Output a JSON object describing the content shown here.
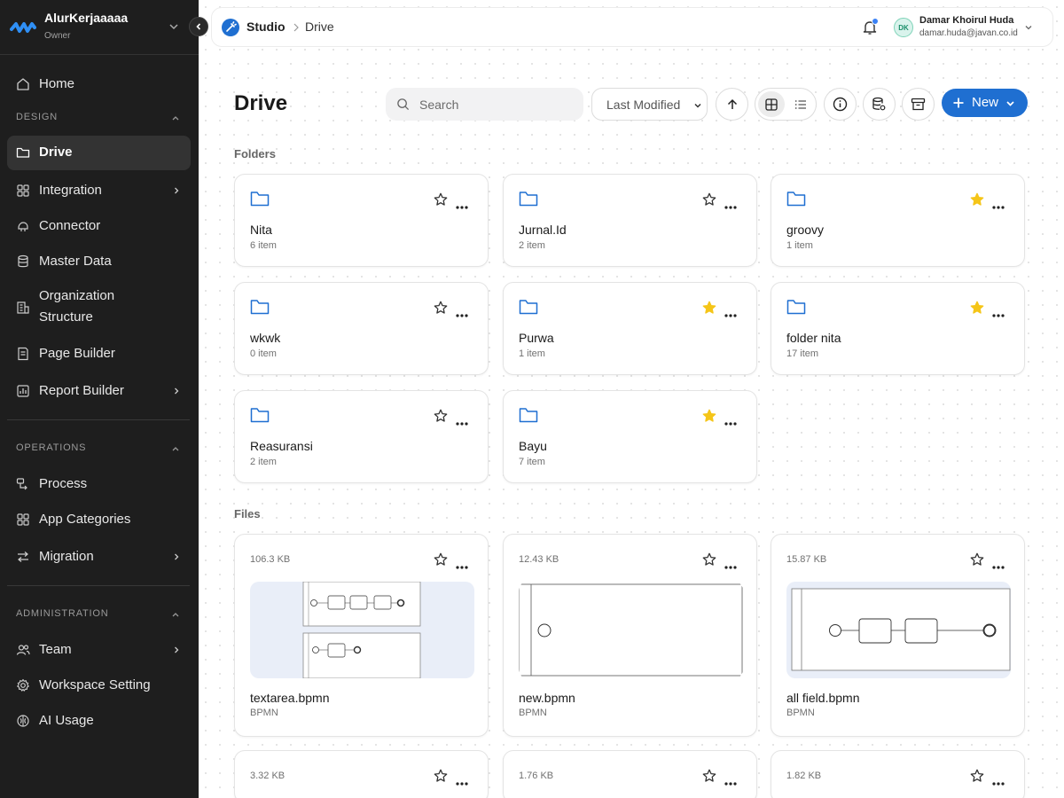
{
  "workspace": {
    "name": "AlurKerjaaaaa",
    "role": "Owner"
  },
  "sidebar": {
    "home": "Home",
    "design_label": "DESIGN",
    "design_items": [
      "Drive",
      "Integration",
      "Connector",
      "Master Data",
      "Organization",
      "Structure",
      "Page Builder",
      "Report Builder"
    ],
    "operations_label": "OPERATIONS",
    "operations_items": [
      "Process",
      "App Categories",
      "Migration"
    ],
    "administration_label": "ADMINISTRATION",
    "administration_items": [
      "Team",
      "Workspace Setting",
      "AI Usage"
    ],
    "active": "Drive"
  },
  "topbar": {
    "breadcrumb": [
      "Studio",
      "Drive"
    ],
    "user_name": "Damar Khoirul Huda",
    "user_email": "damar.huda@javan.co.id",
    "user_initials": "DK"
  },
  "toolbar": {
    "title": "Drive",
    "search_placeholder": "Search",
    "sort_value": "Last Modified",
    "new_label": "New"
  },
  "sections": {
    "folders": "Folders",
    "files": "Files"
  },
  "folders": [
    {
      "name": "Nita",
      "count": "6 item",
      "starred": false
    },
    {
      "name": "Jurnal.Id",
      "count": "2 item",
      "starred": false
    },
    {
      "name": "groovy",
      "count": "1 item",
      "starred": true
    },
    {
      "name": "wkwk",
      "count": "0 item",
      "starred": false
    },
    {
      "name": "Purwa",
      "count": "1 item",
      "starred": true
    },
    {
      "name": "folder nita",
      "count": "17 item",
      "starred": true
    },
    {
      "name": "Reasuransi",
      "count": "2 item",
      "starred": false
    },
    {
      "name": "Bayu",
      "count": "7 item",
      "starred": true
    }
  ],
  "files": [
    {
      "size": "106.3 KB",
      "name": "textarea.bpmn",
      "type": "BPMN"
    },
    {
      "size": "12.43 KB",
      "name": "new.bpmn",
      "type": "BPMN"
    },
    {
      "size": "15.87 KB",
      "name": "all field.bpmn",
      "type": "BPMN"
    },
    {
      "size": "3.32 KB"
    },
    {
      "size": "1.76 KB"
    },
    {
      "size": "1.82 KB"
    }
  ],
  "colors": {
    "accent": "#1f6fd1",
    "star_active": "#f5c518",
    "sidebar_bg": "#1e1e1e"
  }
}
